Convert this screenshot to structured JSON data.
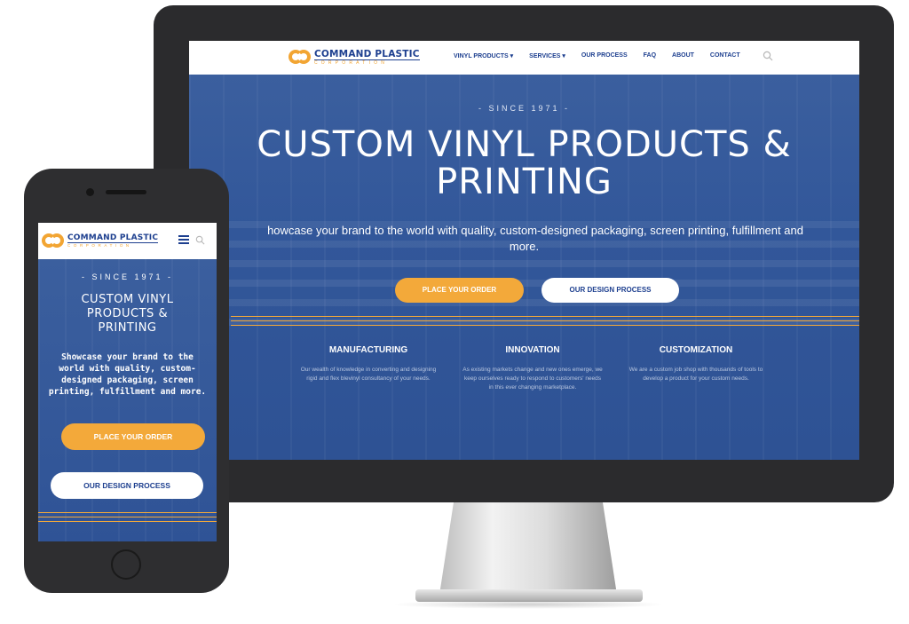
{
  "brand": {
    "name": "COMMAND PLASTIC",
    "subtitle": "CORPORATION",
    "colors": {
      "primary": "#1d3f8f",
      "accent": "#f3a93a",
      "hero_bg": "#3358a0"
    }
  },
  "desktop": {
    "nav": {
      "items": [
        {
          "label": "VINYL PRODUCTS ▾"
        },
        {
          "label": "SERVICES ▾"
        },
        {
          "label": "OUR PROCESS"
        },
        {
          "label": "FAQ"
        },
        {
          "label": "ABOUT"
        },
        {
          "label": "CONTACT"
        }
      ],
      "search_icon": "search-icon"
    },
    "hero": {
      "since": "- SINCE 1971 -",
      "title_line1": "CUSTOM VINYL PRODUCTS &",
      "title_line2": "PRINTING",
      "subtitle_line1": "howcase your brand to the world with quality, custom-designed packaging, screen printing, fulfillment and",
      "subtitle_line2": "more.",
      "primary_button": "PLACE YOUR ORDER",
      "secondary_button": "OUR DESIGN PROCESS"
    },
    "features": [
      {
        "title": "MANUFACTURING",
        "text": "Our wealth of knowledge in converting and designing rigid and flex blevinyl consultancy of your needs."
      },
      {
        "title": "INNOVATION",
        "text": "As existing markets change and new ones emerge, we keep ourselves ready to respond to customers' needs in this ever changing marketplace."
      },
      {
        "title": "CUSTOMIZATION",
        "text": "We are a custom job shop with thousands of tools to develop a product for your custom needs."
      }
    ]
  },
  "mobile": {
    "nav": {
      "menu_icon": "hamburger-icon",
      "search_icon": "search-icon"
    },
    "hero": {
      "since": "- SINCE 1971 -",
      "title_line1": "CUSTOM VINYL",
      "title_line2": "PRODUCTS &",
      "title_line3": "PRINTING",
      "subtitle_line1": "Showcase your brand to the",
      "subtitle_line2": "world with quality, custom-",
      "subtitle_line3": "designed packaging, screen",
      "subtitle_line4": "printing, fulfillment and more.",
      "primary_button": "PLACE YOUR ORDER",
      "secondary_button": "OUR DESIGN PROCESS"
    }
  }
}
